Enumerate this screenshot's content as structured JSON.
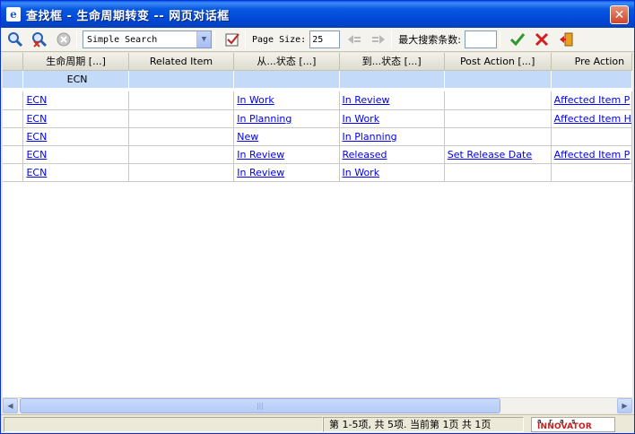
{
  "window": {
    "title": "查找框 - 生命周期转变 -- 网页对话框",
    "close_glyph": "✕"
  },
  "toolbar": {
    "search_mode": "Simple Search",
    "page_size_label": "Page Size:",
    "page_size_value": "25",
    "max_results_label": "最大搜索条数:",
    "max_results_value": ""
  },
  "grid": {
    "columns": [
      "生命周期 [...]",
      "Related Item",
      "从...状态 [...]",
      "到...状态 [...]",
      "Post Action [...]",
      "Pre Action"
    ],
    "filter_row": [
      "ECN",
      "",
      "",
      "",
      "",
      ""
    ],
    "rows": [
      [
        "ECN",
        "",
        "In Work",
        "In Review",
        "",
        "Affected Item P"
      ],
      [
        "ECN",
        "",
        "In Planning",
        "In Work",
        "",
        "Affected Item H"
      ],
      [
        "ECN",
        "",
        "New",
        "In Planning",
        "",
        ""
      ],
      [
        "ECN",
        "",
        "In Review",
        "Released",
        "Set Release Date",
        "Affected Item P"
      ],
      [
        "ECN",
        "",
        "In Review",
        "In Work",
        "",
        ""
      ]
    ]
  },
  "statusbar": {
    "page_info": "第 1-5项, 共 5项. 当前第 1页 共 1页",
    "logo_top": "a r a s",
    "logo_main": "INNOVATOR"
  },
  "colors": {
    "titlebar": "#0046D5",
    "filter_row": "#C3DAF9",
    "link": "#0000EE",
    "logo_red": "#C0201E"
  }
}
